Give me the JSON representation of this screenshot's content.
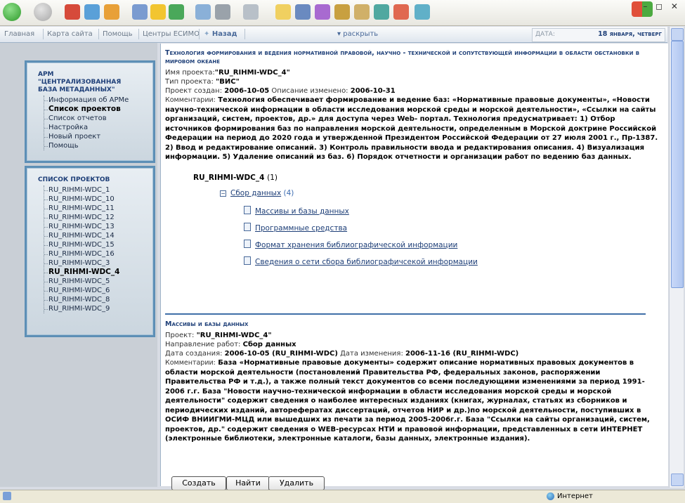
{
  "navbar": {
    "items": [
      "Главная",
      "Карта сайта",
      "Помощь",
      "Центры ЕСИМО"
    ],
    "back_label": "Назад",
    "expand_label": "раскрыть",
    "date_label": "ДАТА:",
    "date_value": "18 января, четверг"
  },
  "status": {
    "zone": "Интернет"
  },
  "sidebar": {
    "arm_box": {
      "title": "АРМ \"Централизованная база метаданных\"",
      "items": [
        "Информация об АРМе",
        "Список проектов",
        "Список отчетов",
        "Настройка",
        "Новый проект",
        "Помощь"
      ],
      "active_index": 1
    },
    "projects_box": {
      "title": "Список проектов",
      "items": [
        "RU_RIHMI-WDC_1",
        "RU_RIHMI-WDC_10",
        "RU_RIHMI-WDC_11",
        "RU_RIHMI-WDC_12",
        "RU_RIHMI-WDC_13",
        "RU_RIHMI-WDC_14",
        "RU_RIHMI-WDC_15",
        "RU_RIHMI-WDC_16",
        "RU_RIHMI-WDC_3",
        "RU_RIHMI-WDC_4",
        "RU_RIHMI-WDC_5",
        "RU_RIHMI-WDC_6",
        "RU_RIHMI-WDC_8",
        "RU_RIHMI-WDC_9"
      ],
      "active_index": 9
    }
  },
  "project": {
    "title": "Технология формирования и ведения нормативной правовой, научно - технической и сопутствующей информации в области обстановки в мировом океане",
    "name_label": "Имя проекта:",
    "name_value": "\"RU_RIHMI-WDC_4\"",
    "type_label": "Тип проекта:",
    "type_value": "\"ВИС\"",
    "created_label": "Проект создан:",
    "created_value": "2006-10-05",
    "changed_label": "Описание изменено:",
    "changed_value": "2006-10-31",
    "comment_label": "Комментарии:",
    "comment_text": "Технология обеспечивает формирование и ведение баз: «Нормативные правовые документы», «Новости научно-технической информации в области исследования морской среды и морской деятельности», «Ссылки на сайты организаций, систем, проектов, др.» для доступа через Web- портал. Технология предусматривает: 1) Отбор источников формирования баз по направления морской деятельности, определенным в Морской доктрине Российской Федерации на период до 2020 года и утвержденной Президентом Российской Федерации от 27 июля 2001 г., Пр-1387. 2) Ввод и редактирование описаний. 3) Контроль правильности ввода и редактирования описания. 4) Визуализация информации. 5) Удаление описаний из баз. 6) Порядок отчетности и организации работ по ведению баз данных."
  },
  "tree": {
    "root_label": "RU_RIHMI-WDC_4",
    "root_count": "(1)",
    "group_label": "Сбор данных",
    "group_count": "(4)",
    "children": [
      "Массивы и базы данных",
      "Программные средства",
      "Формат хранения библиографической информации",
      "Сведения о сети сбора библиографичсекой информации"
    ]
  },
  "detail": {
    "title": "Массивы и базы данных",
    "project_label": "Проект:",
    "project_value": "\"RU_RIHMI-WDC_4\"",
    "direction_label": "Направление работ:",
    "direction_value": "Сбор данных",
    "created_label": "Дата создания:",
    "created_value": "2006-10-05 (RU_RIHMI-WDC)",
    "changed_label": "Дата изменения:",
    "changed_value": "2006-11-16 (RU_RIHMI-WDC)",
    "comment_label": "Комментарии:",
    "comment_text": "База «Нормативные правовые документы» содержит описание нормативных правовых документов в области морской деятельности (постановлений Правительства РФ, федеральных законов, распоряжении Правительства РФ и т.д.), а также полный текст документов со всеми последующими изменениями за период 1991-2006 г.г. База \"Новости научно-технической информации в области исследования морской среды и морской деятельности\" содержит сведения о наиболее интересных изданиях (книгах, журналах, статьях из сборников и периодических изданий, авторефератах диссертаций, отчетов НИР и др.)по морской деятельности, поступивших в ОСИФ ВНИИГМИ-МЦД или вышедших из печати за период 2005-2006г.г. База \"Ссылки на сайты организаций, систем, проектов, др.\" содержит сведения о WEB-ресурсах НТИ и правовой информации, представленных в сети ИНТЕРНЕТ (электронные библиотеки, электронные каталоги, базы данных, электронные издания)."
  },
  "buttons": {
    "create": "Создать",
    "find": "Найти",
    "delete": "Удалить"
  }
}
